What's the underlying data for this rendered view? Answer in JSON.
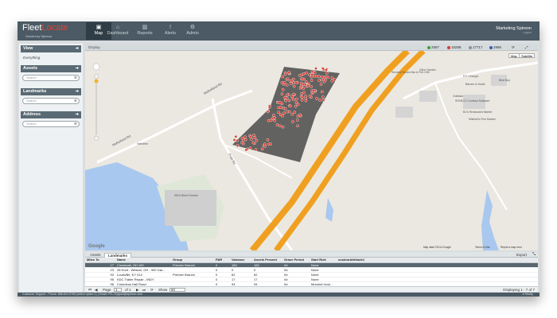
{
  "header": {
    "logo_main": "Fleet",
    "logo_accent": "Locate",
    "logo_sub": "Guided by Spireon",
    "nav": [
      {
        "label": "Map",
        "icon": "map"
      },
      {
        "label": "Dashboard",
        "icon": "home"
      },
      {
        "label": "Reports",
        "icon": "chart"
      },
      {
        "label": "Alerts",
        "icon": "bell"
      },
      {
        "label": "Admin",
        "icon": "gear"
      }
    ],
    "user_name": "Marketing Spireon",
    "user_sub": "Logout"
  },
  "sidebar": {
    "view": {
      "title": "View",
      "value": "Everything"
    },
    "assets": {
      "title": "Assets",
      "placeholder": "Search"
    },
    "landmarks": {
      "title": "Landmarks",
      "placeholder": "Search"
    },
    "address": {
      "title": "Address",
      "placeholder": "Search"
    }
  },
  "map": {
    "crumb": "Display",
    "stats": [
      {
        "value": "2587",
        "color": "#3aa335"
      },
      {
        "value": "18288",
        "color": "#d23c2f"
      },
      {
        "value": "17717",
        "color": "#8a8f93"
      },
      {
        "value": "2996",
        "color": "#3c5fb0"
      }
    ],
    "map_type": "Map",
    "satellite": "Satellite",
    "road_labels": [
      "Mulholland Rd",
      "Mulholland Rd",
      "Pratt Rd"
    ],
    "place_labels": [
      "Smokey Bones Bar & Fire Grill",
      "Olive Garden",
      "P.F. Chang's",
      "Barnes & Noble",
      "Outback",
      "Best Buy",
      "SPARCO Contract Software",
      "BJ's Restaurant Market",
      "Mitchell's Fish Market",
      "Valvoline",
      "IKEA West Chester"
    ],
    "attribution": "Map data ©2014 Google",
    "terms": "Terms of Use",
    "report": "Report a map error",
    "google": "Google"
  },
  "grid": {
    "tabs": [
      "Assets",
      "Landmarks"
    ],
    "active_tab": "Landmarks",
    "export": "Export",
    "headers": [
      "Miles To",
      "Name",
      "Group",
      "PAR",
      "Variance",
      "Assets Present",
      "Grace Period",
      "Start Rule",
      "customAttribute1"
    ],
    "rows": [
      [
        "17",
        "Cincinnati, OH 100",
        "Premier Branch",
        "0",
        "183",
        "183",
        "0d",
        "None",
        ""
      ],
      [
        "23",
        "28 Hunt - Weston, OH - 900 Gar...",
        "",
        "0",
        "0",
        "0",
        "0d",
        "None",
        ""
      ],
      [
        "93",
        "Louisville, KY 014",
        "Premier Branch",
        "0",
        "62",
        "62",
        "0d",
        "None",
        ""
      ],
      [
        "95",
        "KDC Trailer Repair - INDY",
        "",
        "0",
        "17",
        "17",
        "0d",
        "None",
        ""
      ],
      [
        "96",
        "Columbus Hall Road",
        "",
        "0",
        "94",
        "94",
        "0d",
        "Moment Invol...",
        ""
      ],
      [
        "98",
        "Indianapolis Branch",
        "",
        "0",
        "183",
        "183",
        "0d",
        "None",
        ""
      ]
    ],
    "pager": {
      "page_label": "Page",
      "page": "1",
      "of": "of 1",
      "show_label": "Show",
      "show_value": "50",
      "displaying": "Displaying 1 - 7 of 7"
    }
  },
  "footer": {
    "support": "Customer Support - Phone: 888-624-5768 (select option 2) | Email: FFL-Support@spireon.com",
    "status": "Ready"
  },
  "colors": {
    "header": "#4b5a64",
    "accent": "#d4473b",
    "road": "#f0a020",
    "water": "#a9c8ef"
  }
}
